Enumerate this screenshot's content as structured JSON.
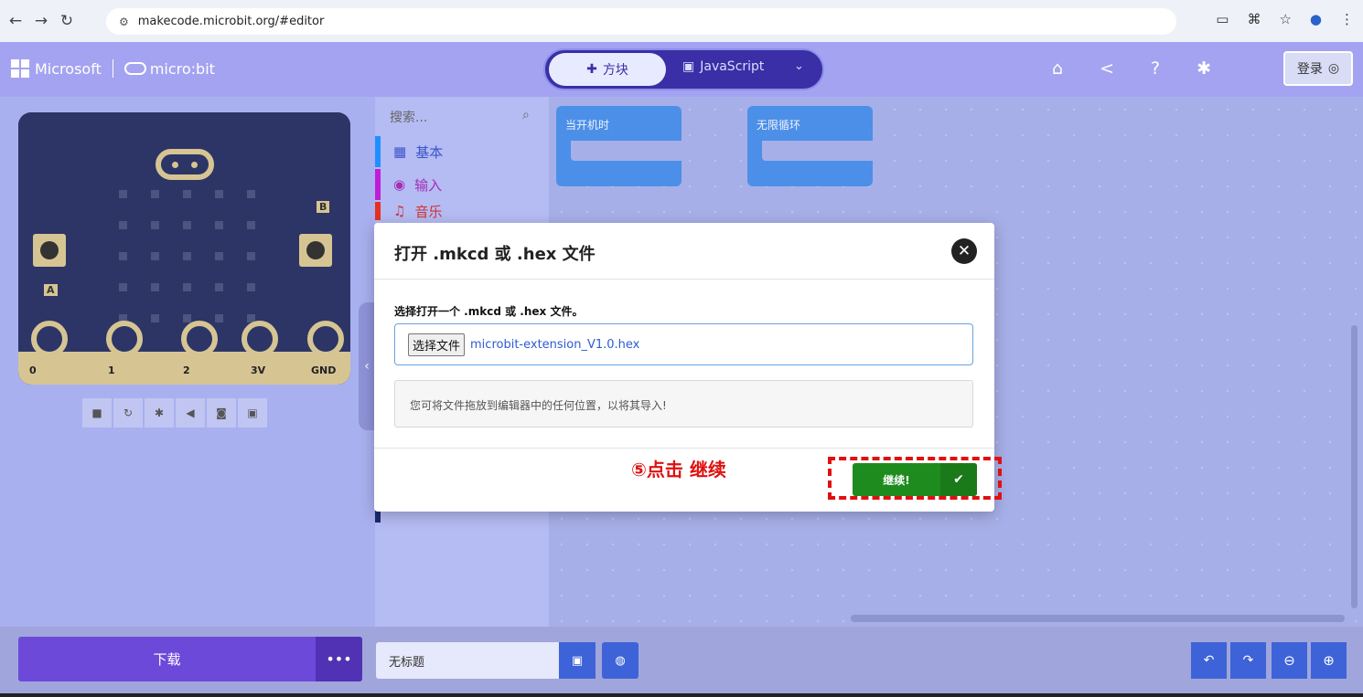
{
  "browser": {
    "url": "makecode.microbit.org/#editor"
  },
  "header": {
    "ms_brand": "Microsoft",
    "mb_brand": "micro:bit",
    "blocks_tab": "方块",
    "js_tab": "JavaScript",
    "login": "登录"
  },
  "simulator": {
    "pins": [
      "0",
      "1",
      "2",
      "3V",
      "GND"
    ],
    "btn_a": "A",
    "btn_b": "B"
  },
  "toolbox": {
    "search_placeholder": "搜索...",
    "categories": [
      {
        "label": "基本",
        "color": "#1e90ff"
      },
      {
        "label": "输入",
        "color": "#c11cd8"
      },
      {
        "label": "音乐",
        "color": "#e63022"
      }
    ]
  },
  "workspace": {
    "blocks": [
      "当开机时",
      "无限循环"
    ]
  },
  "bottom": {
    "download": "下载",
    "more": "•••",
    "project_name": "无标题"
  },
  "dialog": {
    "title": "打开 .mkcd 或 .hex 文件",
    "prompt": "选择打开一个 .mkcd 或 .hex 文件。",
    "choose_file": "选择文件",
    "file_name": "microbit-extension_V1.0.hex",
    "hint": "您可将文件拖放到编辑器中的任何位置，以将其导入!",
    "continue": "继续!"
  },
  "annotation": {
    "text": "⑤点击 继续"
  },
  "colors": {
    "header": "#5a58e5",
    "continue": "#1e8b1e",
    "annotation": "#e01010",
    "download": "#6d49d9"
  }
}
